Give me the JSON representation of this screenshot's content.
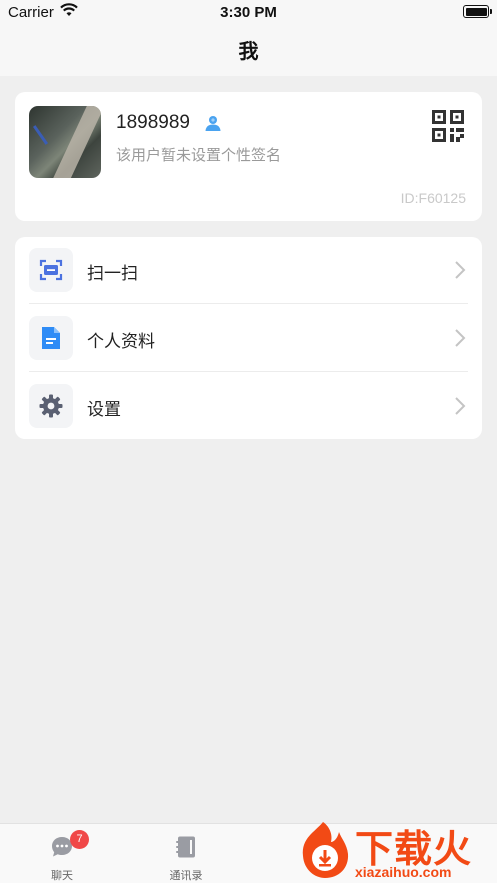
{
  "status_bar": {
    "carrier": "Carrier",
    "time": "3:30 PM"
  },
  "nav": {
    "title": "我"
  },
  "profile": {
    "username": "1898989",
    "signature": "该用户暂未设置个性签名",
    "user_id": "ID:F60125"
  },
  "menu": {
    "items": [
      {
        "label": "扫一扫",
        "icon": "scan-icon"
      },
      {
        "label": "个人资料",
        "icon": "document-icon"
      },
      {
        "label": "设置",
        "icon": "gear-icon"
      }
    ]
  },
  "tabbar": {
    "tabs": [
      {
        "label": "聊天",
        "icon": "chat-icon",
        "badge": "7"
      },
      {
        "label": "通讯录",
        "icon": "contacts-icon"
      }
    ]
  },
  "watermark": {
    "title": "下载火",
    "url": "xiazaihuo.com"
  },
  "colors": {
    "accent_blue": "#3d8bfd",
    "badge_red": "#f04848",
    "watermark_orange": "#f24a15"
  }
}
